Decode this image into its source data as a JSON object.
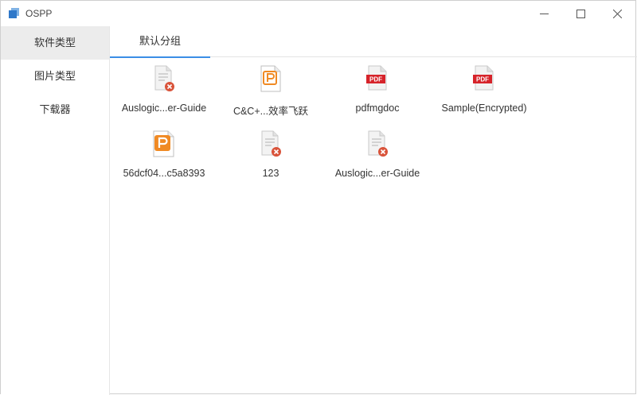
{
  "window": {
    "title": "OSPP",
    "accent": "#3a8ee6"
  },
  "sidebar": {
    "items": [
      {
        "label": "软件类型",
        "active": true
      },
      {
        "label": "图片类型",
        "active": false
      },
      {
        "label": "下载器",
        "active": false
      }
    ]
  },
  "tabs": [
    {
      "label": "默认分组",
      "active": true
    }
  ],
  "files": [
    {
      "name": "Auslogic...er-Guide",
      "icon": "broken-file-icon"
    },
    {
      "name": "C&C+...效率飞跃",
      "icon": "wps-presentation-outline-icon"
    },
    {
      "name": "pdfmgdoc",
      "icon": "pdf-icon"
    },
    {
      "name": "Sample(Encrypted)",
      "icon": "pdf-icon"
    },
    {
      "name": "56dcf04...c5a8393",
      "icon": "wps-presentation-icon"
    },
    {
      "name": "123",
      "icon": "broken-file-icon"
    },
    {
      "name": "Auslogic...er-Guide",
      "icon": "broken-file-icon"
    }
  ]
}
